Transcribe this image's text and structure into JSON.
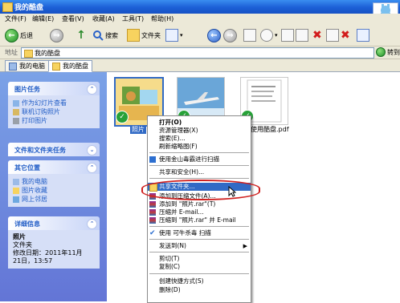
{
  "window": {
    "title": "我的酷盘"
  },
  "menu": [
    "文件(F)",
    "编辑(E)",
    "查看(V)",
    "收藏(A)",
    "工具(T)",
    "帮助(H)"
  ],
  "toolbar": {
    "back_label": "后退",
    "search_label": "搜索",
    "folders_label": "文件夹"
  },
  "address": {
    "label": "地址",
    "value": "我的酷盘",
    "go_label": "转到"
  },
  "tabs": [
    {
      "label": "我的电脑"
    },
    {
      "label": "我的酷盘"
    }
  ],
  "sidebar": {
    "picture_tasks": {
      "title": "图片任务",
      "items": [
        "作为幻灯片查看",
        "联机订购照片",
        "打印图片"
      ]
    },
    "file_tasks": {
      "title": "文件和文件夹任务"
    },
    "other_places": {
      "title": "其它位置",
      "items": [
        "我的电脑",
        "图片收藏",
        "网上邻居"
      ]
    },
    "details": {
      "title": "详细信息",
      "name": "照片",
      "type": "文件夹",
      "modified": "修改日期：2011年11月21日，13:57"
    }
  },
  "files": [
    {
      "caption": "照片"
    },
    {
      "caption": ""
    },
    {
      "caption": "使用酷盘.pdf"
    }
  ],
  "context_menu": {
    "items": [
      {
        "label": "打开(O)",
        "bold": true
      },
      {
        "label": "资源管理器(X)"
      },
      {
        "label": "搜索(E)..."
      },
      {
        "label": "刷新缩略图(F)"
      },
      {
        "label": "使用金山毒霸进行扫描",
        "icon": "shield-icon"
      },
      {
        "label": "共享和安全(H)..."
      },
      {
        "label": "共享文件夹...",
        "icon": "share-folder-icon"
      },
      {
        "label": "添加到压缩文件(A)...",
        "icon": "winrar-icon"
      },
      {
        "label": "添加到 \"照片.rar\"(T)",
        "icon": "winrar-icon"
      },
      {
        "label": "压缩并 E-mail...",
        "icon": "winrar-icon"
      },
      {
        "label": "压缩到 \"照片.rar\" 并 E-mail",
        "icon": "winrar-icon"
      },
      {
        "label": "使用 可牛杀毒 扫描",
        "icon": "antivirus-icon"
      },
      {
        "label": "发送到(N)"
      },
      {
        "label": "剪切(T)"
      },
      {
        "label": "复制(C)"
      },
      {
        "label": "创建快捷方式(S)"
      },
      {
        "label": "删除(D)"
      }
    ]
  },
  "colors": {
    "title_blue": "#1c5fd6",
    "sidebar_blue": "#6375d6",
    "highlight_red": "#d0211f",
    "selection": "#316ac5"
  }
}
